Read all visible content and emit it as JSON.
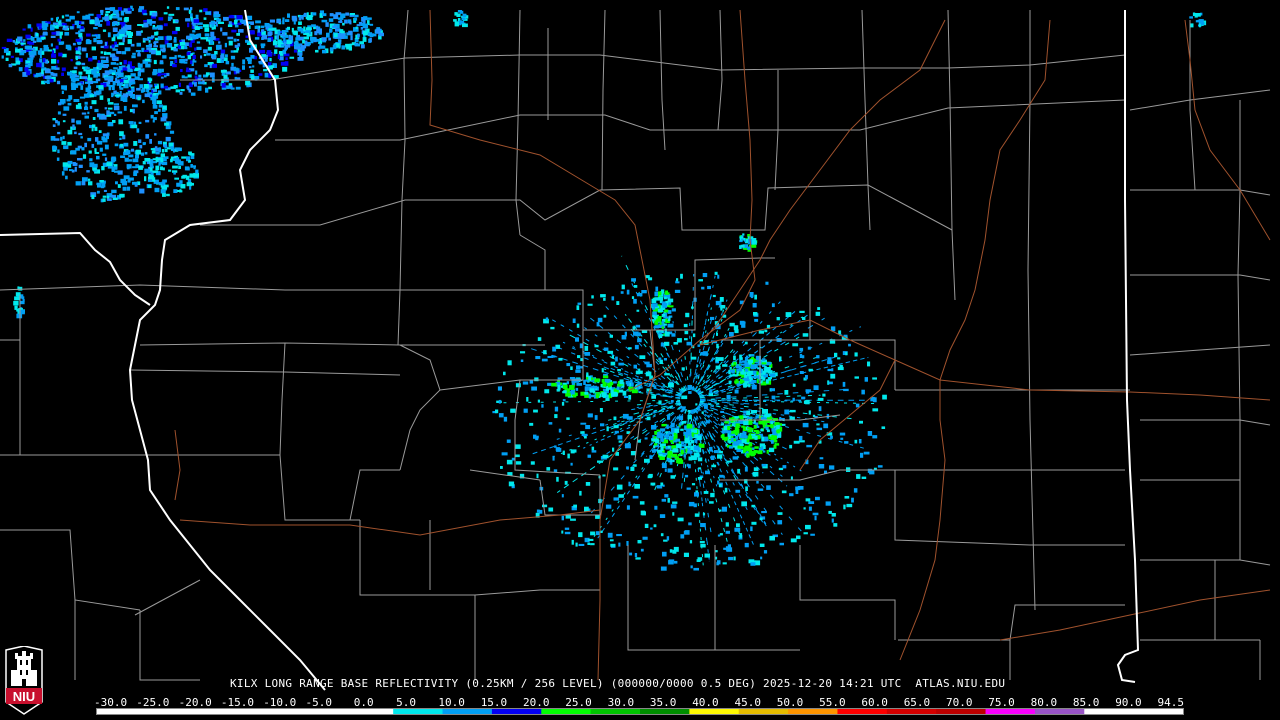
{
  "product": {
    "title": "KILX LONG RANGE BASE REFLECTIVITY (0.25KM / 256 LEVEL) (000000/0000 0.5 DEG) 2025-12-20 14:21 UTC  ATLAS.NIU.EDU"
  },
  "scale": {
    "labels": [
      "-30.0",
      "-25.0",
      "-20.0",
      "-15.0",
      "-10.0",
      "-5.0",
      "0.0",
      "5.0",
      "10.0",
      "15.0",
      "20.0",
      "25.0",
      "30.0",
      "35.0",
      "40.0",
      "45.0",
      "50.0",
      "55.0",
      "60.0",
      "65.0",
      "70.0",
      "75.0",
      "80.0",
      "85.0",
      "90.0",
      "94.5"
    ],
    "colors": [
      "#000000",
      "#000000",
      "#000000",
      "#000000",
      "#000000",
      "#000000",
      "#00e8ec",
      "#019ff4",
      "#0300f4",
      "#02fd02",
      "#01c501",
      "#008e00",
      "#fdf802",
      "#e5bc00",
      "#fd9500",
      "#fd0000",
      "#d40000",
      "#bc0000",
      "#f800fd",
      "#9854c6",
      "#fdfdfd",
      "#fdfdfd"
    ]
  },
  "logo": {
    "text": "NIU",
    "color": "#c8102e"
  },
  "map": {
    "state_border_color": "#ffffff",
    "county_border_color": "#9a9a9a",
    "highway_color": "#a0522d",
    "radar_site": "KILX"
  }
}
